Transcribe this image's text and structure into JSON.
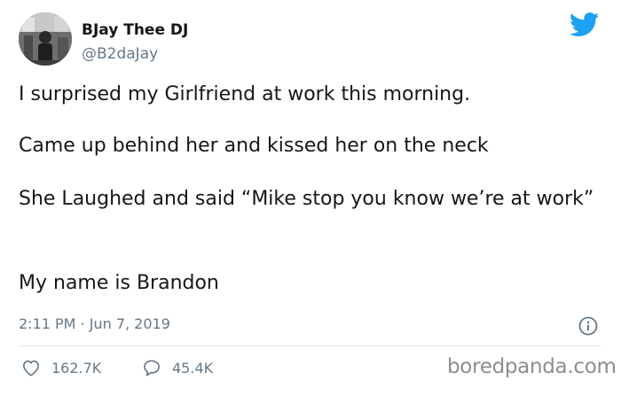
{
  "author": {
    "display_name": "BJay Thee DJ",
    "handle": "@B2daJay"
  },
  "tweet": {
    "paragraphs": [
      "I surprised my Girlfriend at work this morning.",
      "Came up behind her and kissed her on the neck",
      "She Laughed and said “Mike stop you know we’re at work”",
      "My name is Brandon"
    ],
    "timestamp": "2:11 PM · Jun 7, 2019"
  },
  "engagement": {
    "likes": "162.7K",
    "replies": "45.4K"
  },
  "watermark": "boredpanda.com",
  "icons": {
    "brand": "twitter-bird-icon",
    "info": "info-icon",
    "like": "heart-icon",
    "reply": "reply-bubble-icon"
  },
  "colors": {
    "twitter_blue": "#1da1f2",
    "text_primary": "#14171a",
    "text_secondary": "#657786",
    "divider": "#e1e8ed"
  }
}
